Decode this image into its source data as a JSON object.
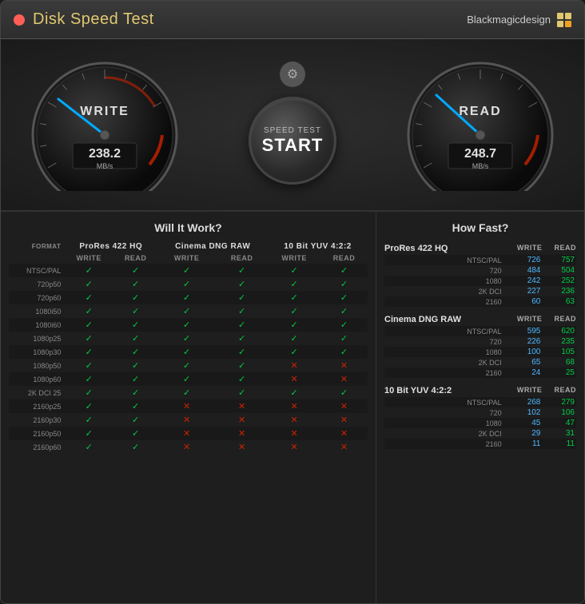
{
  "window": {
    "title": "Disk Speed Test",
    "brand": "Blackmagicdesign",
    "close_label": "×"
  },
  "gauges": {
    "write": {
      "label": "WRITE",
      "value": "238.2",
      "unit": "MB/s",
      "needle_angle": -35
    },
    "read": {
      "label": "READ",
      "value": "248.7",
      "unit": "MB/s",
      "needle_angle": -30
    }
  },
  "start_button": {
    "line1": "SPEED TEST",
    "line2": "START"
  },
  "gear_icon": "⚙",
  "sections": {
    "left_title": "Will It Work?",
    "right_title": "How Fast?"
  },
  "will_it_work": {
    "codecs": [
      "ProRes 422 HQ",
      "Cinema DNG RAW",
      "10 Bit YUV 4:2:2"
    ],
    "col_headers": [
      "WRITE",
      "READ",
      "WRITE",
      "READ",
      "WRITE",
      "READ"
    ],
    "rows": [
      {
        "format": "FORMAT",
        "header": true
      },
      {
        "format": "NTSC/PAL",
        "values": [
          true,
          true,
          true,
          true,
          true,
          true
        ]
      },
      {
        "format": "720p50",
        "values": [
          true,
          true,
          true,
          true,
          true,
          true
        ]
      },
      {
        "format": "720p60",
        "values": [
          true,
          true,
          true,
          true,
          true,
          true
        ]
      },
      {
        "format": "1080i50",
        "values": [
          true,
          true,
          true,
          true,
          true,
          true
        ]
      },
      {
        "format": "1080i60",
        "values": [
          true,
          true,
          true,
          true,
          true,
          true
        ]
      },
      {
        "format": "1080p25",
        "values": [
          true,
          true,
          true,
          true,
          true,
          true
        ]
      },
      {
        "format": "1080p30",
        "values": [
          true,
          true,
          true,
          true,
          true,
          true
        ]
      },
      {
        "format": "1080p50",
        "values": [
          true,
          true,
          true,
          true,
          false,
          false
        ]
      },
      {
        "format": "1080p60",
        "values": [
          true,
          true,
          true,
          true,
          false,
          false
        ]
      },
      {
        "format": "2K DCI 25",
        "values": [
          true,
          true,
          true,
          true,
          true,
          true
        ]
      },
      {
        "format": "2160p25",
        "values": [
          true,
          true,
          false,
          false,
          false,
          false
        ]
      },
      {
        "format": "2160p30",
        "values": [
          true,
          true,
          false,
          false,
          false,
          false
        ]
      },
      {
        "format": "2160p50",
        "values": [
          true,
          true,
          false,
          false,
          false,
          false
        ]
      },
      {
        "format": "2160p60",
        "values": [
          true,
          true,
          false,
          false,
          false,
          false
        ]
      }
    ]
  },
  "how_fast": {
    "groups": [
      {
        "codec": "ProRes 422 HQ",
        "rows": [
          {
            "label": "NTSC/PAL",
            "write": 726,
            "read": 757
          },
          {
            "label": "720",
            "write": 484,
            "read": 504
          },
          {
            "label": "1080",
            "write": 242,
            "read": 252
          },
          {
            "label": "2K DCI",
            "write": 227,
            "read": 236
          },
          {
            "label": "2160",
            "write": 60,
            "read": 63
          }
        ]
      },
      {
        "codec": "Cinema DNG RAW",
        "rows": [
          {
            "label": "NTSC/PAL",
            "write": 595,
            "read": 620
          },
          {
            "label": "720",
            "write": 226,
            "read": 235
          },
          {
            "label": "1080",
            "write": 100,
            "read": 105
          },
          {
            "label": "2K DCI",
            "write": 65,
            "read": 68
          },
          {
            "label": "2160",
            "write": 24,
            "read": 25
          }
        ]
      },
      {
        "codec": "10 Bit YUV 4:2:2",
        "rows": [
          {
            "label": "NTSC/PAL",
            "write": 268,
            "read": 279
          },
          {
            "label": "720",
            "write": 102,
            "read": 106
          },
          {
            "label": "1080",
            "write": 45,
            "read": 47
          },
          {
            "label": "2K DCI",
            "write": 29,
            "read": 31
          },
          {
            "label": "2160",
            "write": 11,
            "read": 11
          }
        ]
      }
    ]
  }
}
